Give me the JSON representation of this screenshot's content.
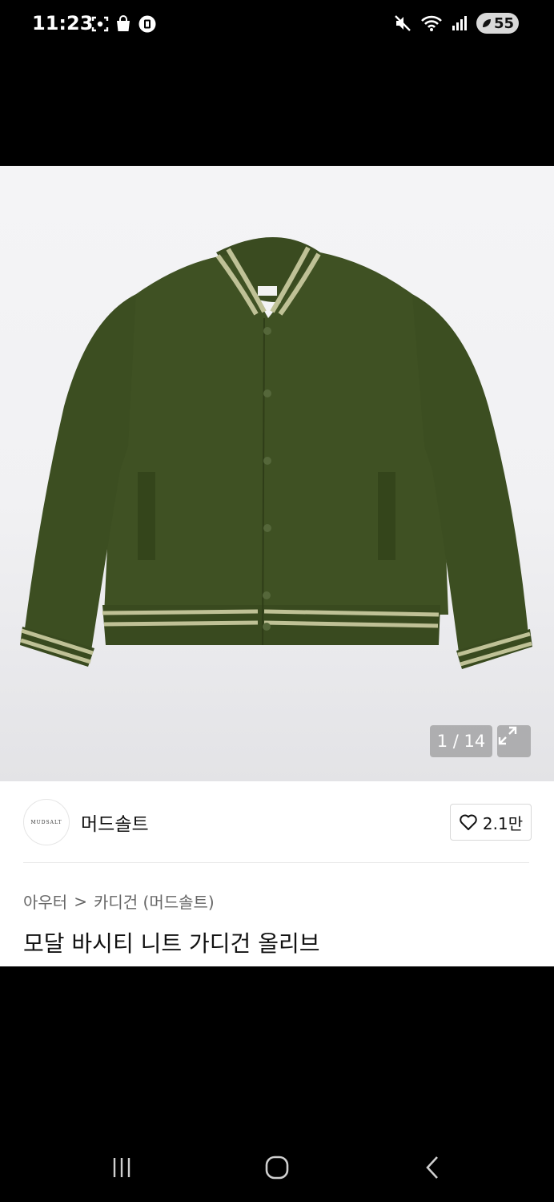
{
  "status_bar": {
    "time": "11:23",
    "left_icons": [
      "screenshot-icon",
      "shopping-bag-icon",
      "app-notification-icon"
    ],
    "right_icons": [
      "mute-icon",
      "wifi-icon",
      "signal-icon"
    ],
    "battery": "55"
  },
  "gallery": {
    "image_description_icon": "green-varsity-knit-cardigan",
    "counter": "1 / 14",
    "expand_icon": "expand-icon"
  },
  "brand": {
    "logo_text": "MUDSALT",
    "name": "머드솔트"
  },
  "like": {
    "count": "2.1만"
  },
  "breadcrumb": {
    "category": "아우터",
    "separator": ">",
    "subcategory": "카디건 (머드솔트)"
  },
  "product": {
    "title": "모달 바시티 니트 가디건 올리브"
  },
  "nav": {
    "recents_icon": "recents-icon",
    "home_icon": "home-icon",
    "back_icon": "back-icon"
  },
  "colors": {
    "jacket": "#3f5123",
    "stripe": "#bfc196"
  }
}
